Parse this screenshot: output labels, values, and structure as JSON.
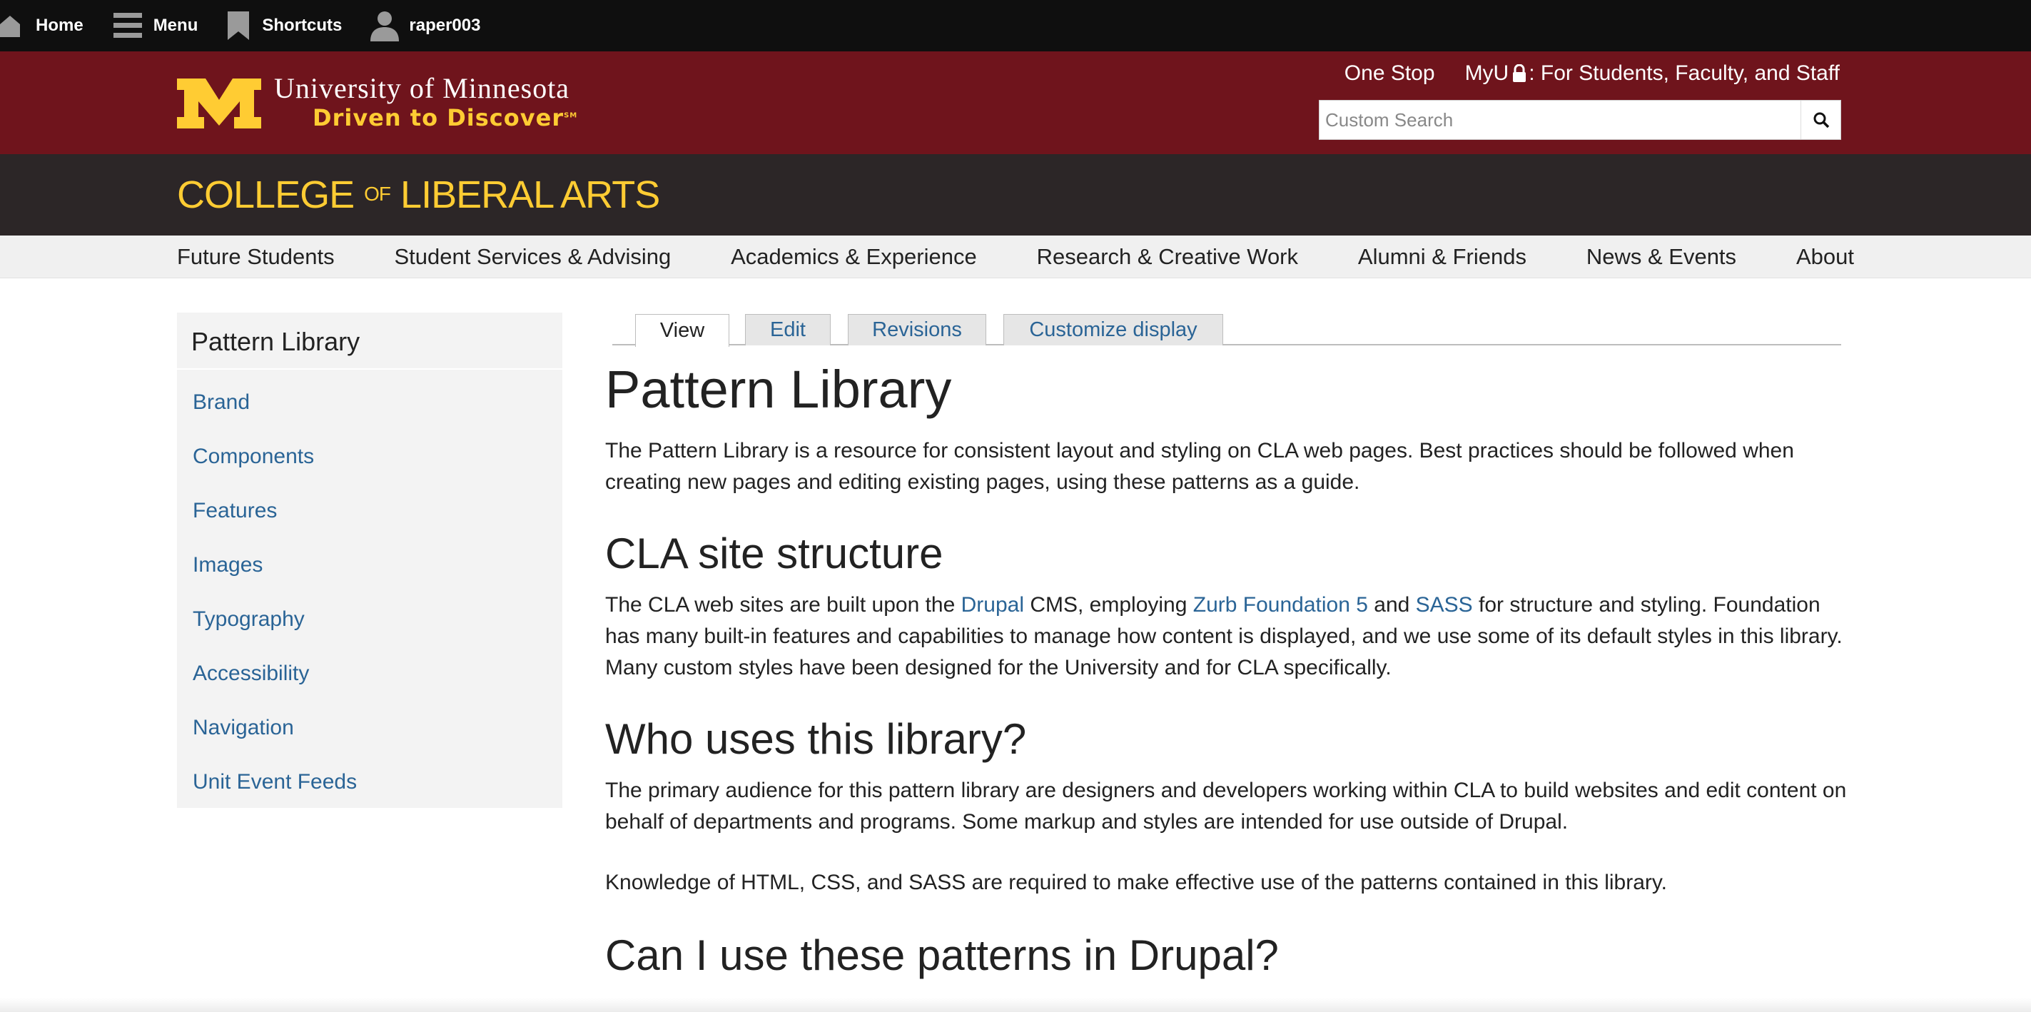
{
  "toolbar": {
    "home_label": "Home",
    "menu_label": "Menu",
    "shortcuts_label": "Shortcuts",
    "user_label": "raper003"
  },
  "header": {
    "wordmark": "University of Minnesota",
    "tagline": "Driven to Discover",
    "tagline_mark": "SM",
    "one_stop": "One Stop",
    "myu_prefix": "MyU",
    "myu_suffix": ": For Students, Faculty, and Staff",
    "search_placeholder": "Custom Search",
    "brand_maroon": "#6f141c",
    "brand_gold": "#ffcc33"
  },
  "college": {
    "title_part1": "COLLEGE",
    "title_of": "OF",
    "title_part2": "LIBERAL ARTS"
  },
  "main_nav": {
    "items": [
      "Future Students",
      "Student Services & Advising",
      "Academics & Experience",
      "Research & Creative Work",
      "Alumni & Friends",
      "News & Events",
      "About"
    ]
  },
  "sidebar": {
    "title": "Pattern Library",
    "items": [
      "Brand",
      "Components",
      "Features",
      "Images",
      "Typography",
      "Accessibility",
      "Navigation",
      "Unit Event Feeds"
    ]
  },
  "tabs": {
    "items": [
      "View",
      "Edit",
      "Revisions",
      "Customize display"
    ],
    "active": "View"
  },
  "content": {
    "title": "Pattern Library",
    "intro": "The Pattern Library is a resource for consistent layout and styling on CLA web pages. Best practices should be followed when creating new pages and editing existing pages, using these patterns as a guide.",
    "structure_heading": "CLA site structure",
    "structure_p1": "The CLA web sites are built upon the ",
    "structure_link1": "Drupal",
    "structure_p2": " CMS, employing ",
    "structure_link2": "Zurb Foundation 5",
    "structure_p3": " and ",
    "structure_link3": "SASS",
    "structure_p4": " for structure and styling. Foundation has many built-in features and capabilities to manage how content is displayed, and we use some of its default styles in this library. Many custom styles have been designed for the University and for CLA specifically.",
    "who_heading": "Who uses this library?",
    "who_p": "The primary audience for this pattern library are designers and developers working within CLA to build websites and edit content on behalf of departments and programs. Some markup and styles are intended for use outside of Drupal.",
    "knowledge_p": "Knowledge of HTML, CSS, and SASS are required to make effective use of the patterns contained in this library.",
    "drupal_heading": "Can I use these patterns in Drupal?"
  }
}
